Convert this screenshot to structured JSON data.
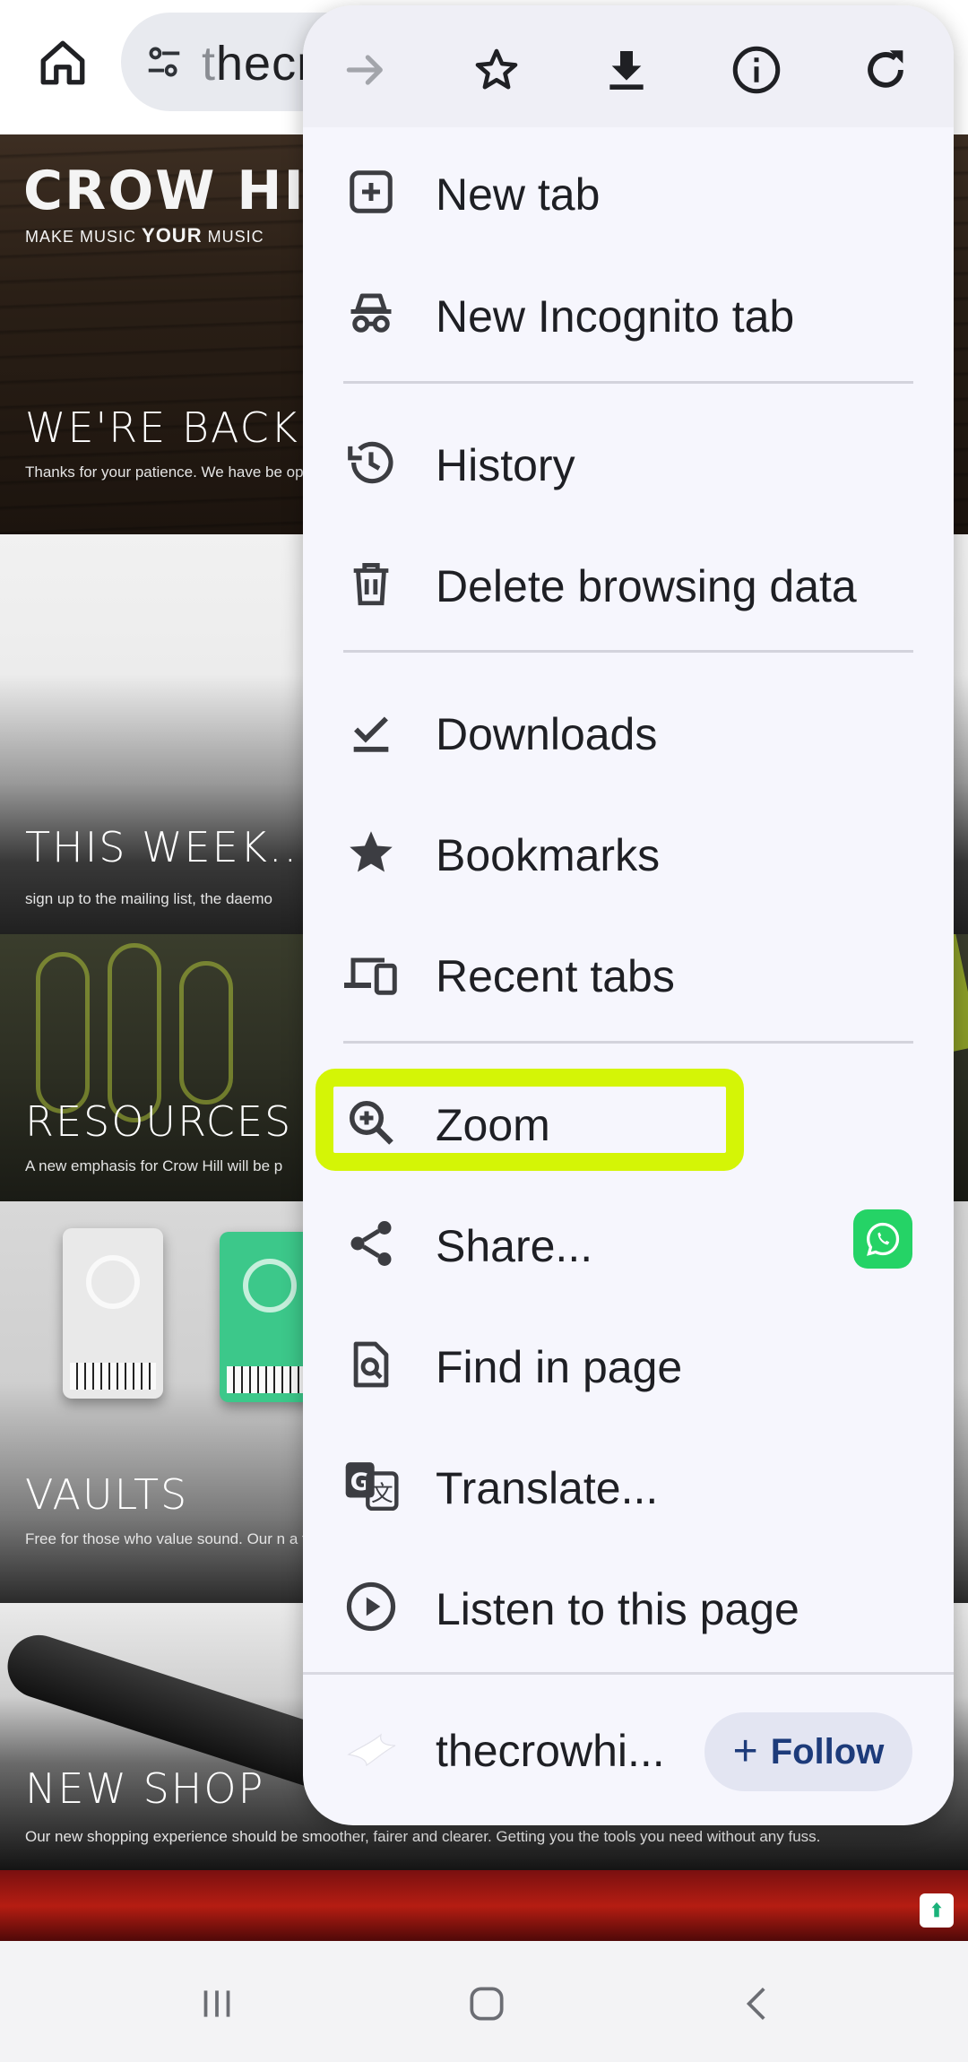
{
  "browser": {
    "url_visible": "thecr",
    "url_first_char": "t",
    "url_rest": "hecr"
  },
  "page": {
    "brand": {
      "logo": "CROW HILL",
      "tagline_before": "MAKE MUSIC ",
      "tagline_bold": "YOUR",
      "tagline_after": " MUSIC"
    },
    "panels": [
      {
        "title": "WE'RE BACK",
        "text": "Thanks for your patience. We have be opportunity!"
      },
      {
        "title": "THIS WEEK...",
        "text": "sign up to the mailing list, the daemo"
      },
      {
        "title": "RESOURCES",
        "text": "A new emphasis for Crow Hill will be p"
      },
      {
        "title": "VAULTS",
        "text": "Free for those who value sound. Our n a twist?"
      },
      {
        "title": "NEW SHOP",
        "text": "Our new shopping experience should be smoother, fairer and clearer. Getting you the tools you need without any fuss."
      }
    ]
  },
  "menu": {
    "toolbar": [
      "forward-icon",
      "bookmark-star-icon",
      "download-icon",
      "info-icon",
      "reload-icon"
    ],
    "items": [
      {
        "label": "New tab",
        "icon": "new-tab-icon"
      },
      {
        "label": "New Incognito tab",
        "icon": "incognito-icon"
      },
      {
        "label": "History",
        "icon": "history-icon"
      },
      {
        "label": "Delete browsing data",
        "icon": "trash-icon"
      },
      {
        "label": "Downloads",
        "icon": "downloads-check-icon"
      },
      {
        "label": "Bookmarks",
        "icon": "star-icon"
      },
      {
        "label": "Recent tabs",
        "icon": "devices-icon"
      },
      {
        "label": "Zoom",
        "icon": "zoom-in-icon"
      },
      {
        "label": "Share...",
        "icon": "share-icon"
      },
      {
        "label": "Find in page",
        "icon": "find-in-page-icon"
      },
      {
        "label": "Translate...",
        "icon": "translate-icon"
      },
      {
        "label": "Listen to this page",
        "icon": "play-circle-icon"
      }
    ],
    "highlighted_item": "Zoom",
    "highlight_color": "#d4f506",
    "site": {
      "name": "thecrowhi...",
      "follow_label": "Follow"
    }
  },
  "colors": {
    "menu_bg": "#f6f6fd",
    "follow_text": "#1d3b7a",
    "whatsapp": "#25d366"
  }
}
